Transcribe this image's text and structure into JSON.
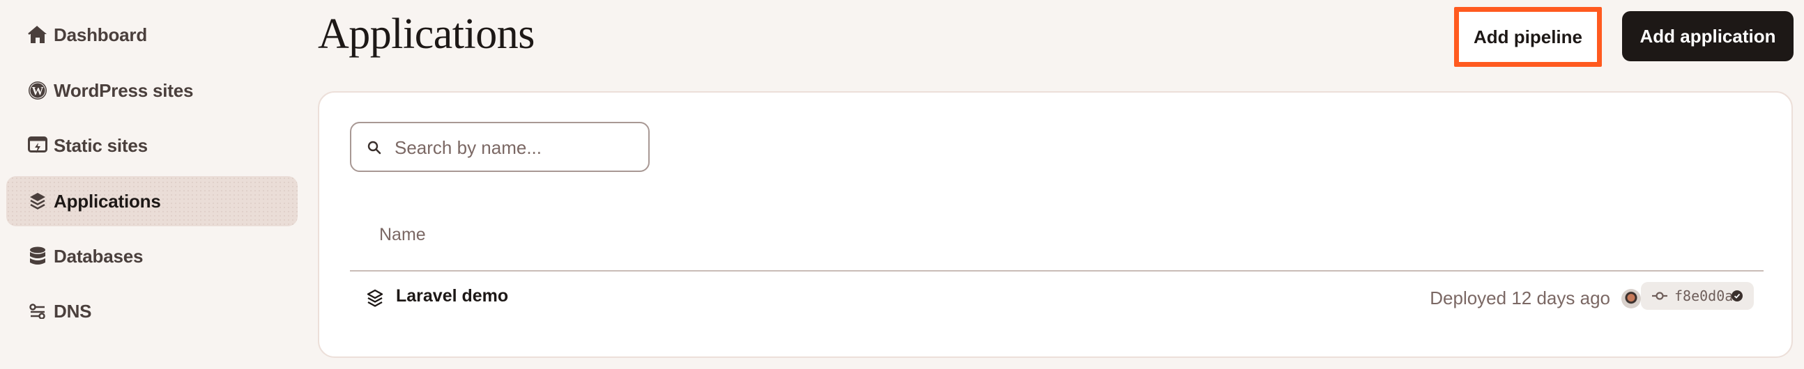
{
  "sidebar": {
    "items": [
      {
        "label": "Dashboard",
        "icon": "home-icon",
        "active": false
      },
      {
        "label": "WordPress sites",
        "icon": "wordpress-icon",
        "active": false
      },
      {
        "label": "Static sites",
        "icon": "static-site-icon",
        "active": false
      },
      {
        "label": "Applications",
        "icon": "layers-icon",
        "active": true
      },
      {
        "label": "Databases",
        "icon": "database-icon",
        "active": false
      },
      {
        "label": "DNS",
        "icon": "dns-icon",
        "active": false
      }
    ]
  },
  "header": {
    "title": "Applications",
    "add_pipeline_label": "Add pipeline",
    "add_application_label": "Add application"
  },
  "search": {
    "placeholder": "Search by name...",
    "value": ""
  },
  "table": {
    "columns": [
      "Name"
    ],
    "rows": [
      {
        "name": "Laravel demo",
        "deployed": "Deployed 12 days ago",
        "commit": "f8e0d0a",
        "commit_status": "verified"
      }
    ]
  },
  "colors": {
    "background": "#f8f4f1",
    "active_nav": "#eaddd7",
    "primary_button": "#1d1816",
    "highlight": "#ff5a1f"
  }
}
